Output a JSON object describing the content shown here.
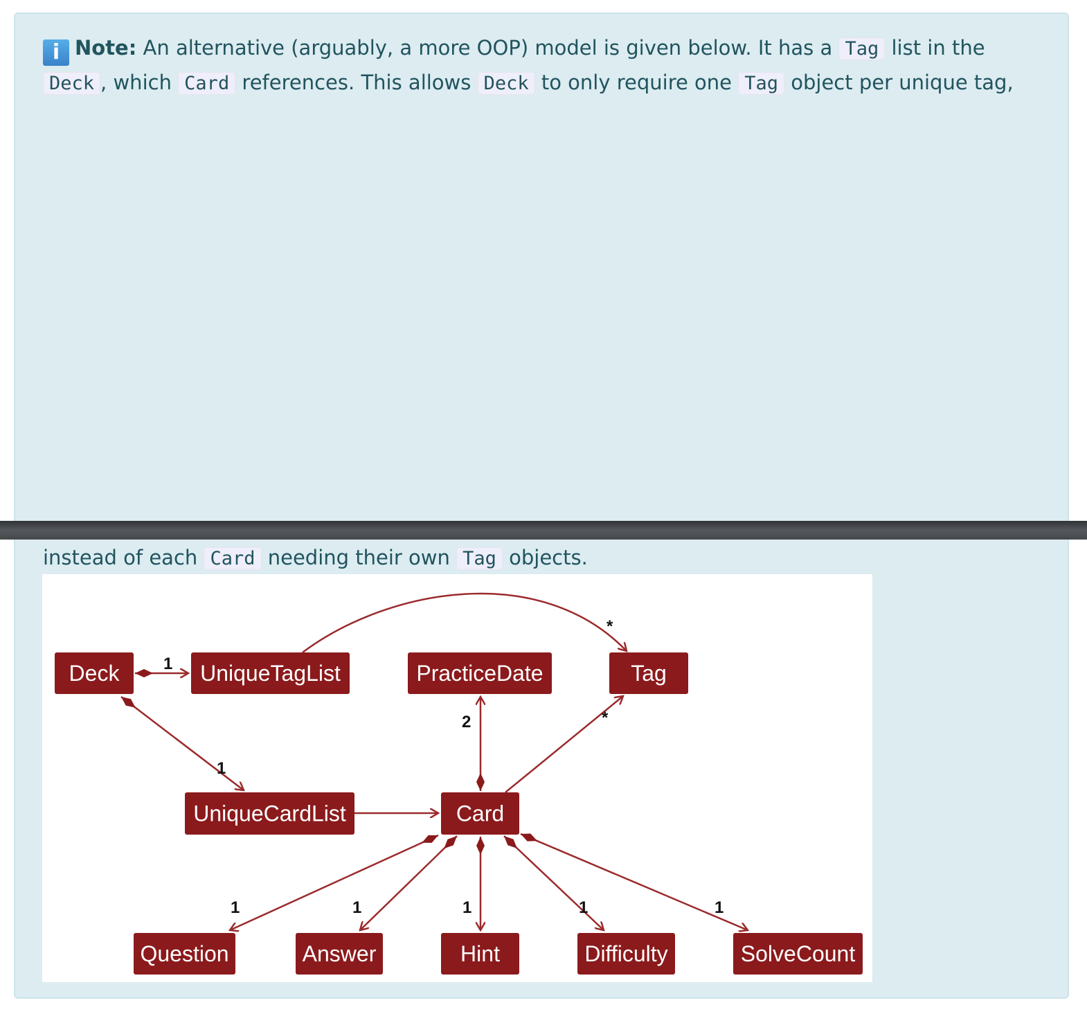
{
  "note": {
    "label": "Note:",
    "line1": [
      "An alternative (arguably, a more OOP) model is given below. It has a ",
      "Tag",
      " list in the"
    ],
    "line2": [
      "Deck",
      ", which ",
      "Card",
      " references. This allows ",
      "Deck",
      " to only require one ",
      "Tag",
      " object per unique tag,"
    ],
    "line3": [
      "instead of each ",
      "Card",
      " needing their own ",
      "Tag",
      " objects."
    ]
  },
  "diagram": {
    "box_color": "#8b1a1c",
    "classes": [
      "Deck",
      "UniqueTagList",
      "PracticeDate",
      "Tag",
      "UniqueCardList",
      "Card",
      "Question",
      "Answer",
      "Hint",
      "Difficulty",
      "SolveCount"
    ],
    "relations": [
      {
        "from": "Deck",
        "to": "UniqueTagList",
        "kind": "composition",
        "multiplicity": "1"
      },
      {
        "from": "Deck",
        "to": "UniqueCardList",
        "kind": "composition",
        "multiplicity": "1"
      },
      {
        "from": "UniqueTagList",
        "to": "Tag",
        "kind": "association",
        "multiplicity": "*"
      },
      {
        "from": "UniqueCardList",
        "to": "Card",
        "kind": "association",
        "multiplicity": ""
      },
      {
        "from": "Card",
        "to": "PracticeDate",
        "kind": "composition",
        "multiplicity": "2"
      },
      {
        "from": "Card",
        "to": "Tag",
        "kind": "association",
        "multiplicity": "*"
      },
      {
        "from": "Card",
        "to": "Question",
        "kind": "composition",
        "multiplicity": "1"
      },
      {
        "from": "Card",
        "to": "Answer",
        "kind": "composition",
        "multiplicity": "1"
      },
      {
        "from": "Card",
        "to": "Hint",
        "kind": "composition",
        "multiplicity": "1"
      },
      {
        "from": "Card",
        "to": "Difficulty",
        "kind": "composition",
        "multiplicity": "1"
      },
      {
        "from": "Card",
        "to": "SolveCount",
        "kind": "composition",
        "multiplicity": "1"
      }
    ]
  }
}
